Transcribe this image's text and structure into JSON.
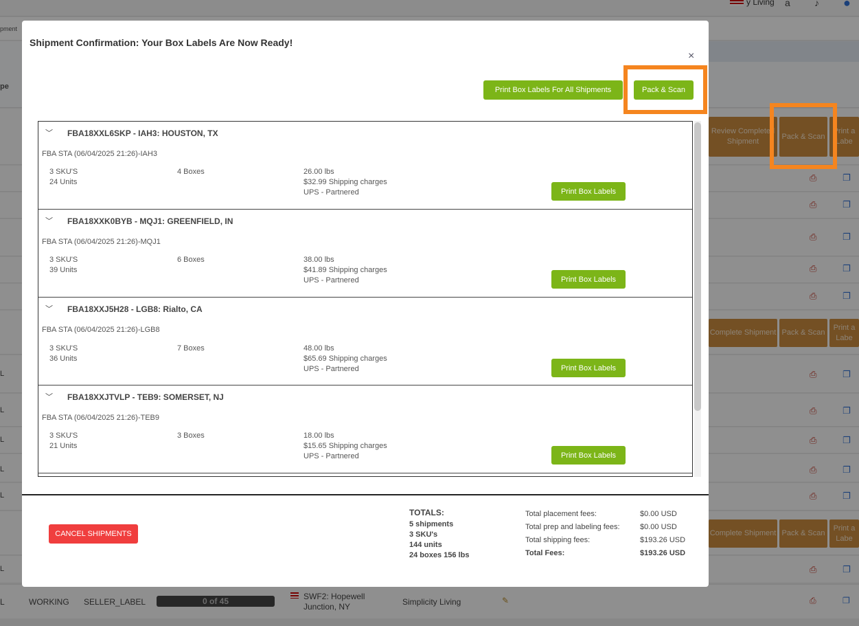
{
  "background": {
    "top_bar": {
      "brand_text": "y Living"
    },
    "breadcrumb_fragment": "pment",
    "column_header_fragment": "pe",
    "row_type_fragment": "L",
    "actions": {
      "review_completed": "Review Completed Shipment",
      "pack_scan": "Pack & Scan",
      "print_labels": "Print a Labe",
      "complete_shipment": "Complete Shipment"
    },
    "bottom_row": {
      "status": "WORKING",
      "label_type": "SELLER_LABEL",
      "progress": "0 of 45",
      "destination": "SWF2: Hopewell Junction, NY",
      "brand": "Simplicity Living"
    }
  },
  "modal": {
    "title": "Shipment Confirmation: Your Box Labels Are Now Ready!",
    "close_label": "×",
    "print_all_label": "Print Box Labels For All Shipments",
    "pack_scan_label": "Pack & Scan",
    "print_label": "Print Box Labels",
    "shipments": [
      {
        "title": "FBA18XXL6SKP - IAH3: HOUSTON, TX",
        "subtitle": "FBA STA (06/04/2025 21:26)-IAH3",
        "skus": "3 SKU'S",
        "units": "24 Units",
        "boxes": "4 Boxes",
        "weight": "26.00 lbs",
        "charges": "$32.99 Shipping charges",
        "carrier": "UPS - Partnered"
      },
      {
        "title": "FBA18XXK0BYB - MQJ1: GREENFIELD, IN",
        "subtitle": "FBA STA (06/04/2025 21:26)-MQJ1",
        "skus": "3 SKU'S",
        "units": "39 Units",
        "boxes": "6 Boxes",
        "weight": "38.00 lbs",
        "charges": "$41.89 Shipping charges",
        "carrier": "UPS - Partnered"
      },
      {
        "title": "FBA18XXJ5H28 - LGB8: Rialto, CA",
        "subtitle": "FBA STA (06/04/2025 21:26)-LGB8",
        "skus": "3 SKU'S",
        "units": "36 Units",
        "boxes": "7 Boxes",
        "weight": "48.00 lbs",
        "charges": "$65.69 Shipping charges",
        "carrier": "UPS - Partnered"
      },
      {
        "title": "FBA18XXJTVLP - TEB9: SOMERSET, NJ",
        "subtitle": "FBA STA (06/04/2025 21:26)-TEB9",
        "skus": "3 SKU'S",
        "units": "21 Units",
        "boxes": "3 Boxes",
        "weight": "18.00 lbs",
        "charges": "$15.65 Shipping charges",
        "carrier": "UPS - Partnered"
      }
    ],
    "cancel_label": "CANCEL SHIPMENTS",
    "totals": {
      "heading": "TOTALS:",
      "shipments": "5 shipments",
      "skus": "3 SKU's",
      "units": "144 units",
      "boxes_weight": "24 boxes 156 lbs"
    },
    "fees": {
      "placement_label": "Total placement fees:",
      "placement_value": "$0.00 USD",
      "prep_label": "Total prep and labeling fees:",
      "prep_value": "$0.00 USD",
      "shipping_label": "Total shipping fees:",
      "shipping_value": "$193.26 USD",
      "total_label": "Total Fees:",
      "total_value": "$193.26 USD"
    }
  },
  "colors": {
    "accent_green": "#7cb518",
    "danger_red": "#f03e3e",
    "highlight_orange": "#f5851f",
    "action_brown": "#c98a3e"
  }
}
